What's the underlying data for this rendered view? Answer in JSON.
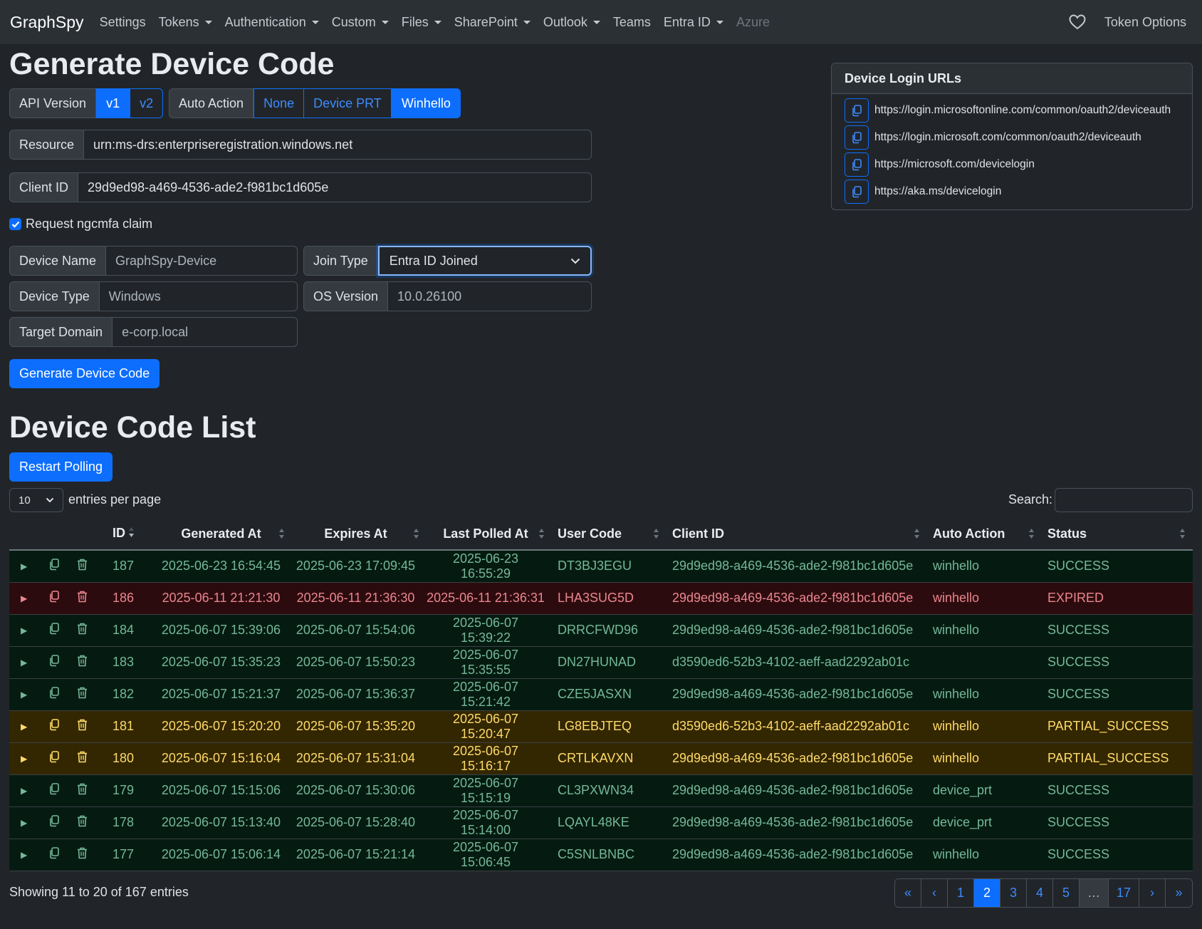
{
  "navbar": {
    "brand": "GraphSpy",
    "items": [
      {
        "label": "Settings",
        "dropdown": false
      },
      {
        "label": "Tokens",
        "dropdown": true
      },
      {
        "label": "Authentication",
        "dropdown": true
      },
      {
        "label": "Custom",
        "dropdown": true
      },
      {
        "label": "Files",
        "dropdown": true
      },
      {
        "label": "SharePoint",
        "dropdown": true
      },
      {
        "label": "Outlook",
        "dropdown": true
      },
      {
        "label": "Teams",
        "dropdown": false
      },
      {
        "label": "Entra ID",
        "dropdown": true
      },
      {
        "label": "Azure",
        "dropdown": false,
        "disabled": true
      }
    ],
    "token_options": "Token Options",
    "heart_icon": "heart-icon"
  },
  "generate": {
    "title": "Generate Device Code",
    "api_version_label": "API Version",
    "api_v1": "v1",
    "api_v2": "v2",
    "auto_action_label": "Auto Action",
    "auto_none": "None",
    "auto_device_prt": "Device PRT",
    "auto_winhello": "Winhello",
    "resource_label": "Resource",
    "resource_value": "urn:ms-drs:enterpriseregistration.windows.net",
    "client_id_label": "Client ID",
    "client_id_value": "29d9ed98-a469-4536-ade2-f981bc1d605e",
    "ngcmfa_label": "Request ngcmfa claim",
    "device_name_label": "Device Name",
    "device_name_placeholder": "GraphSpy-Device",
    "join_type_label": "Join Type",
    "join_type_value": "Entra ID Joined",
    "device_type_label": "Device Type",
    "device_type_placeholder": "Windows",
    "os_version_label": "OS Version",
    "os_version_placeholder": "10.0.26100",
    "target_domain_label": "Target Domain",
    "target_domain_placeholder": "e-corp.local",
    "button": "Generate Device Code"
  },
  "login_urls": {
    "title": "Device Login URLs",
    "urls": [
      "https://login.microsoftonline.com/common/oauth2/deviceauth",
      "https://login.microsoft.com/common/oauth2/deviceauth",
      "https://microsoft.com/devicelogin",
      "https://aka.ms/devicelogin"
    ]
  },
  "list": {
    "title": "Device Code List",
    "restart_button": "Restart Polling",
    "entries_value": "10",
    "entries_label": "entries per page",
    "search_label": "Search:",
    "columns": [
      "ID",
      "Generated At",
      "Expires At",
      "Last Polled At",
      "User Code",
      "Client ID",
      "Auto Action",
      "Status"
    ],
    "rows": [
      {
        "id": "187",
        "generated": "2025-06-23 16:54:45",
        "expires": "2025-06-23 17:09:45",
        "polled": "2025-06-23 16:55:29",
        "user_code": "DT3BJ3EGU",
        "client_id": "29d9ed98-a469-4536-ade2-f981bc1d605e",
        "auto_action": "winhello",
        "status": "SUCCESS"
      },
      {
        "id": "186",
        "generated": "2025-06-11 21:21:30",
        "expires": "2025-06-11 21:36:30",
        "polled": "2025-06-11 21:36:31",
        "user_code": "LHA3SUG5D",
        "client_id": "29d9ed98-a469-4536-ade2-f981bc1d605e",
        "auto_action": "winhello",
        "status": "EXPIRED"
      },
      {
        "id": "184",
        "generated": "2025-06-07 15:39:06",
        "expires": "2025-06-07 15:54:06",
        "polled": "2025-06-07 15:39:22",
        "user_code": "DRRCFWD96",
        "client_id": "29d9ed98-a469-4536-ade2-f981bc1d605e",
        "auto_action": "winhello",
        "status": "SUCCESS"
      },
      {
        "id": "183",
        "generated": "2025-06-07 15:35:23",
        "expires": "2025-06-07 15:50:23",
        "polled": "2025-06-07 15:35:55",
        "user_code": "DN27HUNAD",
        "client_id": "d3590ed6-52b3-4102-aeff-aad2292ab01c",
        "auto_action": "",
        "status": "SUCCESS"
      },
      {
        "id": "182",
        "generated": "2025-06-07 15:21:37",
        "expires": "2025-06-07 15:36:37",
        "polled": "2025-06-07 15:21:42",
        "user_code": "CZE5JASXN",
        "client_id": "29d9ed98-a469-4536-ade2-f981bc1d605e",
        "auto_action": "winhello",
        "status": "SUCCESS"
      },
      {
        "id": "181",
        "generated": "2025-06-07 15:20:20",
        "expires": "2025-06-07 15:35:20",
        "polled": "2025-06-07 15:20:47",
        "user_code": "LG8EBJTEQ",
        "client_id": "d3590ed6-52b3-4102-aeff-aad2292ab01c",
        "auto_action": "winhello",
        "status": "PARTIAL_SUCCESS"
      },
      {
        "id": "180",
        "generated": "2025-06-07 15:16:04",
        "expires": "2025-06-07 15:31:04",
        "polled": "2025-06-07 15:16:17",
        "user_code": "CRTLKAVXN",
        "client_id": "29d9ed98-a469-4536-ade2-f981bc1d605e",
        "auto_action": "winhello",
        "status": "PARTIAL_SUCCESS"
      },
      {
        "id": "179",
        "generated": "2025-06-07 15:15:06",
        "expires": "2025-06-07 15:30:06",
        "polled": "2025-06-07 15:15:19",
        "user_code": "CL3PXWN34",
        "client_id": "29d9ed98-a469-4536-ade2-f981bc1d605e",
        "auto_action": "device_prt",
        "status": "SUCCESS"
      },
      {
        "id": "178",
        "generated": "2025-06-07 15:13:40",
        "expires": "2025-06-07 15:28:40",
        "polled": "2025-06-07 15:14:00",
        "user_code": "LQAYL48KE",
        "client_id": "29d9ed98-a469-4536-ade2-f981bc1d605e",
        "auto_action": "device_prt",
        "status": "SUCCESS"
      },
      {
        "id": "177",
        "generated": "2025-06-07 15:06:14",
        "expires": "2025-06-07 15:21:14",
        "polled": "2025-06-07 15:06:45",
        "user_code": "C5SNLBNBC",
        "client_id": "29d9ed98-a469-4536-ade2-f981bc1d605e",
        "auto_action": "winhello",
        "status": "SUCCESS"
      }
    ],
    "info": "Showing 11 to 20 of 167 entries",
    "pagination": [
      "«",
      "‹",
      "1",
      "2",
      "3",
      "4",
      "5",
      "…",
      "17",
      "›",
      "»"
    ],
    "active_page": "2"
  },
  "colors": {
    "primary": "#0d6efd",
    "success_text": "#75b798",
    "danger_text": "#ea868f",
    "warning_text": "#ffda6a"
  }
}
